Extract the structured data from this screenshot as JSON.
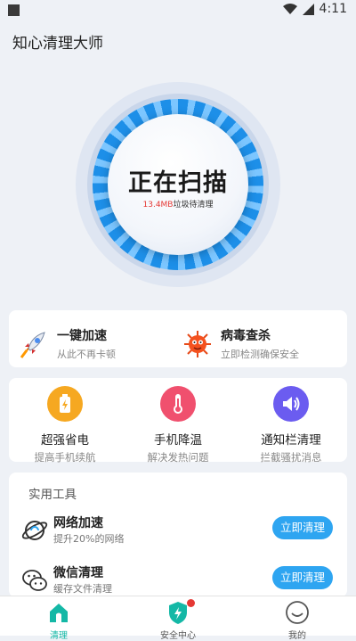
{
  "status_bar": {
    "time": "4:11"
  },
  "app": {
    "title": "知心清理大师"
  },
  "scan": {
    "title": "正在扫描",
    "size": "13.4MB",
    "size_suffix": "垃圾待清理"
  },
  "quick_features": [
    {
      "title": "一键加速",
      "subtitle": "从此不再卡顿",
      "icon": "rocket-icon"
    },
    {
      "title": "病毒查杀",
      "subtitle": "立即检测确保安全",
      "icon": "virus-icon"
    }
  ],
  "tools": [
    {
      "title": "超强省电",
      "subtitle": "提高手机续航",
      "icon": "battery-icon",
      "color": "#f6a821"
    },
    {
      "title": "手机降温",
      "subtitle": "解决发热问题",
      "icon": "thermometer-icon",
      "color": "#f0506e"
    },
    {
      "title": "通知栏清理",
      "subtitle": "拦截骚扰消息",
      "icon": "speaker-icon",
      "color": "#6b5cf0"
    }
  ],
  "utilities": {
    "section_title": "实用工具",
    "items": [
      {
        "title": "网络加速",
        "subtitle": "提升20%的网络",
        "button": "立即清理",
        "icon": "network-icon"
      },
      {
        "title": "微信清理",
        "subtitle": "缓存文件清理",
        "button": "立即清理",
        "icon": "wechat-icon"
      }
    ]
  },
  "bottom_nav": [
    {
      "label": "清理",
      "icon": "home-icon",
      "active": true
    },
    {
      "label": "安全中心",
      "icon": "shield-icon",
      "active": false
    },
    {
      "label": "我的",
      "icon": "smiley-icon",
      "active": false
    }
  ],
  "colors": {
    "accent_blue": "#2ea5f1",
    "active_teal": "#14b8a6",
    "warning_red": "#e53935"
  }
}
